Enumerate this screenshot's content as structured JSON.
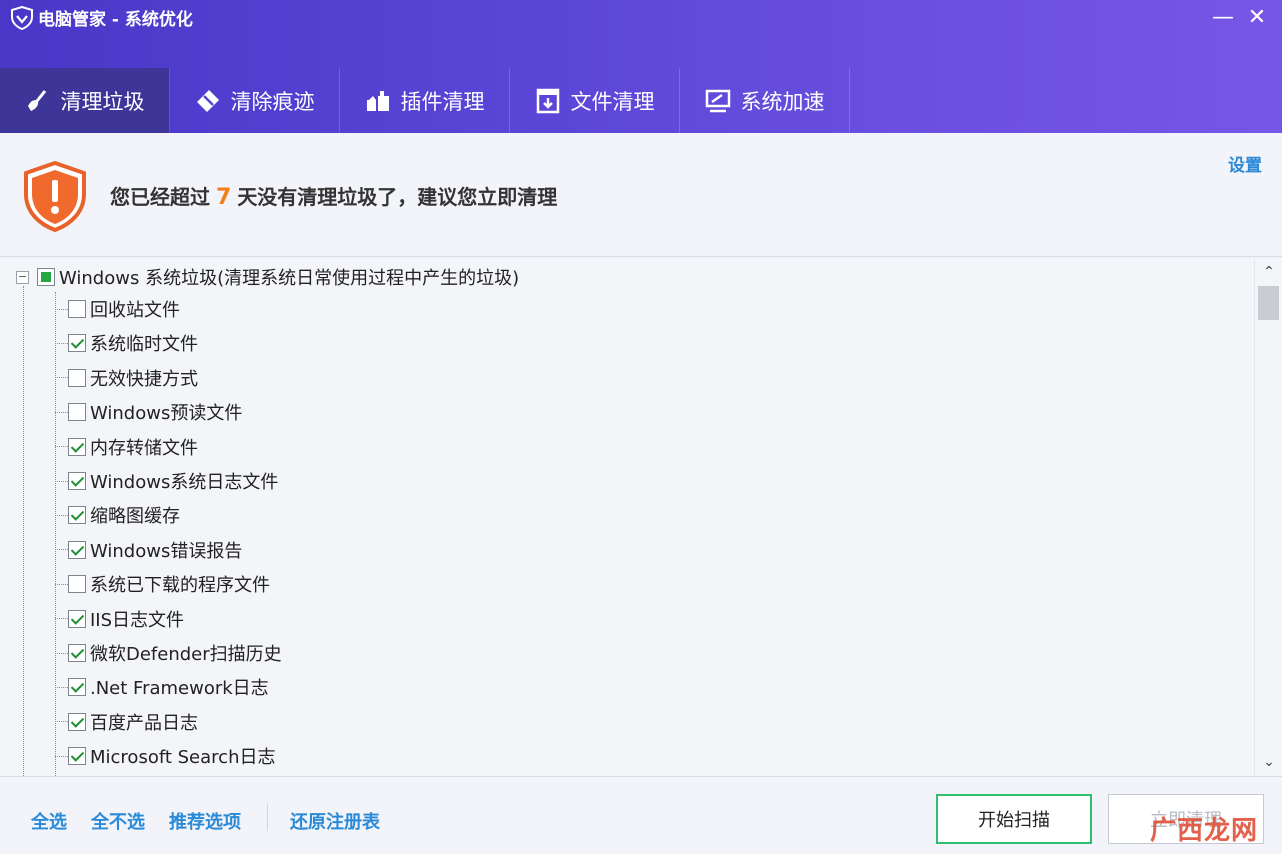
{
  "window": {
    "title": "电脑管家 - 系统优化",
    "minimize": "—",
    "close": "✕"
  },
  "tabs": [
    {
      "label": "清理垃圾",
      "icon": "broom-icon",
      "active": true
    },
    {
      "label": "清除痕迹",
      "icon": "eraser-icon",
      "active": false
    },
    {
      "label": "插件清理",
      "icon": "plugin-icon",
      "active": false
    },
    {
      "label": "文件清理",
      "icon": "file-box-icon",
      "active": false
    },
    {
      "label": "系统加速",
      "icon": "monitor-speed-icon",
      "active": false
    }
  ],
  "banner": {
    "prefix": "您已经超过",
    "days": "7",
    "suffix": "天没有清理垃圾了，建议您立即清理",
    "settings": "设置",
    "icon": "warning-shield-icon",
    "accent": "#f07f1c"
  },
  "tree": {
    "root": {
      "label": "Windows 系统垃圾(清理系统日常使用过程中产生的垃圾)",
      "expander": "−",
      "state": "partial"
    },
    "items": [
      {
        "label": "回收站文件",
        "checked": false
      },
      {
        "label": "系统临时文件",
        "checked": true
      },
      {
        "label": "无效快捷方式",
        "checked": false
      },
      {
        "label": "Windows预读文件",
        "checked": false
      },
      {
        "label": "内存转储文件",
        "checked": true
      },
      {
        "label": "Windows系统日志文件",
        "checked": true
      },
      {
        "label": "缩略图缓存",
        "checked": true
      },
      {
        "label": "Windows错误报告",
        "checked": true
      },
      {
        "label": "系统已下载的程序文件",
        "checked": false
      },
      {
        "label": "IIS日志文件",
        "checked": true
      },
      {
        "label": "微软Defender扫描历史",
        "checked": true
      },
      {
        "label": ".Net Framework日志",
        "checked": true
      },
      {
        "label": "百度产品日志",
        "checked": true
      },
      {
        "label": "Microsoft Search日志",
        "checked": true
      }
    ]
  },
  "scrollbar": {
    "up": "⌃",
    "down": "⌄"
  },
  "footer": {
    "select_all": "全选",
    "select_none": "全不选",
    "recommended": "推荐选项",
    "restore_registry": "还原注册表",
    "scan_button": "开始扫描",
    "clean_button": "立即清理"
  },
  "watermark": "广西龙网"
}
